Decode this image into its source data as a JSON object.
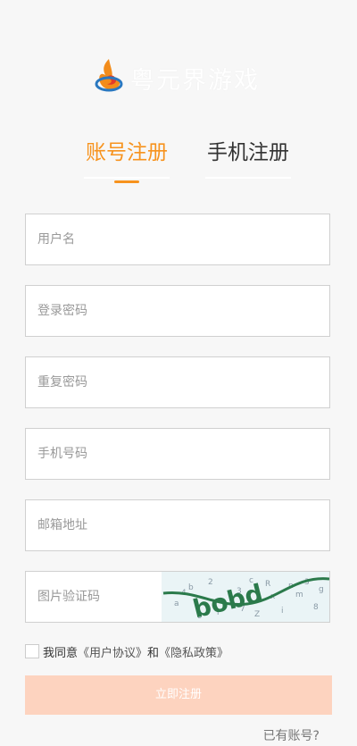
{
  "brand": {
    "logo_text": "粤元界游戏"
  },
  "tabs": [
    {
      "label": "账号注册",
      "active": true
    },
    {
      "label": "手机注册",
      "active": false
    }
  ],
  "form": {
    "username": {
      "placeholder": "用户名",
      "value": ""
    },
    "password": {
      "placeholder": "登录密码",
      "value": ""
    },
    "repeat_password": {
      "placeholder": "重复密码",
      "value": ""
    },
    "phone": {
      "placeholder": "手机号码",
      "value": ""
    },
    "email": {
      "placeholder": "邮箱地址",
      "value": ""
    },
    "captcha": {
      "placeholder": "图片验证码",
      "value": "",
      "image_text": "bobd"
    }
  },
  "agreement": {
    "prefix": "我同意",
    "user_agreement": "《用户协议》",
    "conjunction": "和",
    "privacy_policy": "《隐私政策》"
  },
  "submit_label": "立即注册",
  "login_link": "已有账号?",
  "colors": {
    "accent": "#f7931e",
    "submit_bg": "#fdd3bf",
    "background": "#f7f7f7"
  }
}
